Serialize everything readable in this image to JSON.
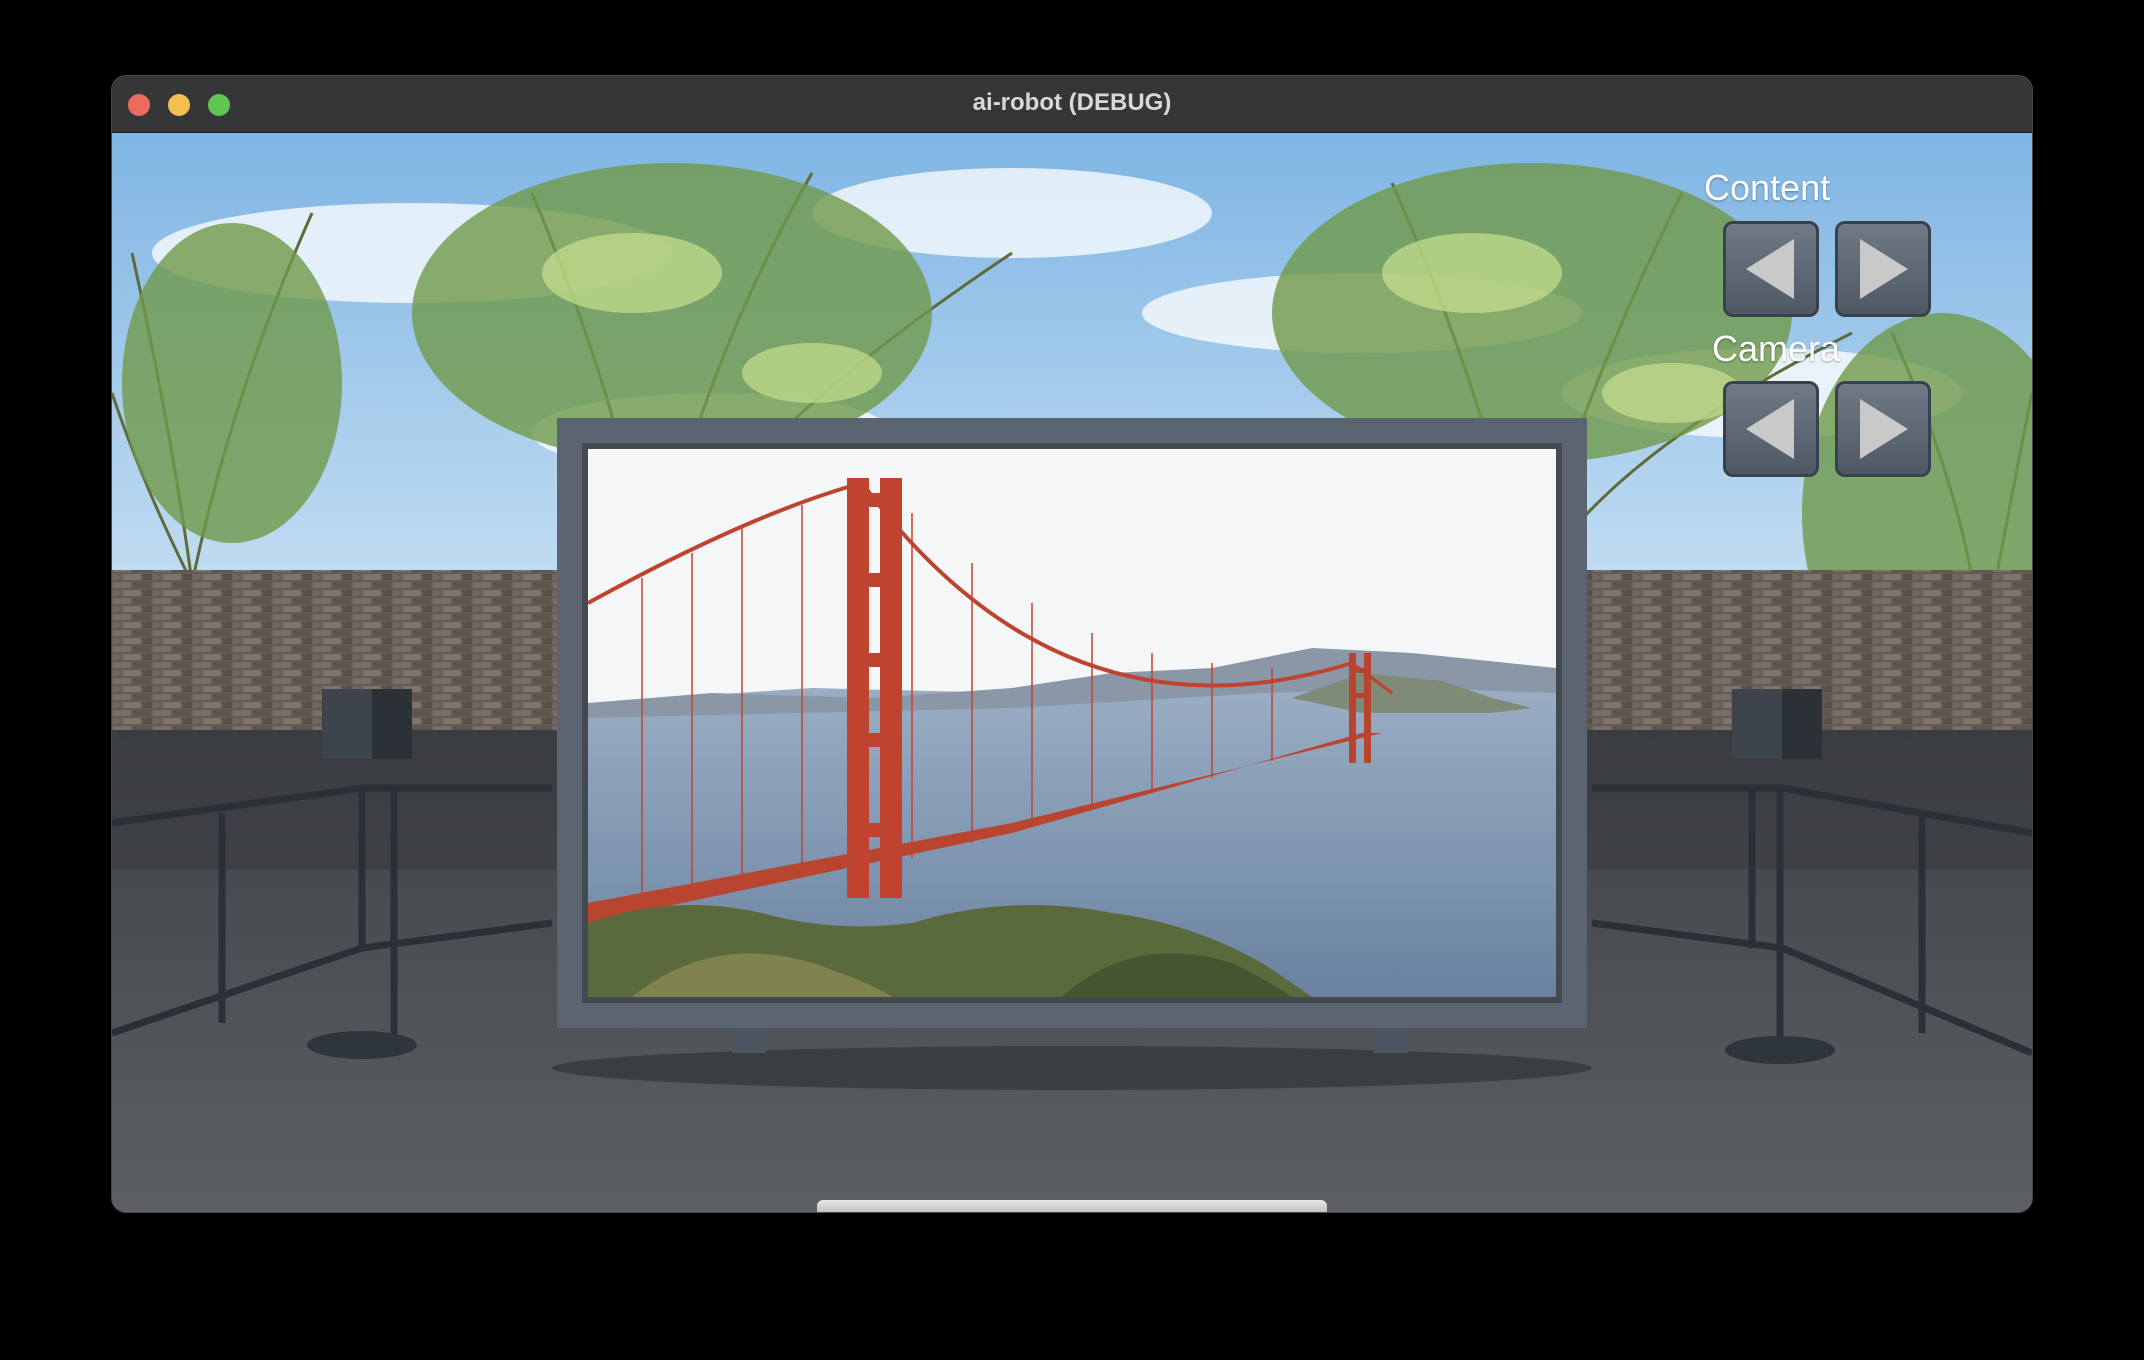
{
  "window": {
    "title": "ai-robot (DEBUG)"
  },
  "controls": {
    "content_label": "Content",
    "camera_label": "Camera",
    "content_prev": "left-arrow-icon",
    "content_next": "right-arrow-icon",
    "camera_prev": "left-arrow-icon",
    "camera_next": "right-arrow-icon"
  },
  "scene": {
    "display_image": "golden-gate-bridge"
  },
  "colors": {
    "sky": "#a9cfee",
    "wall": "#6b6059",
    "floor": "#4d5055",
    "screen_frame": "#596470",
    "bridge": "#c0432f",
    "water": "#7b93ad",
    "button": "#5f6a76"
  }
}
